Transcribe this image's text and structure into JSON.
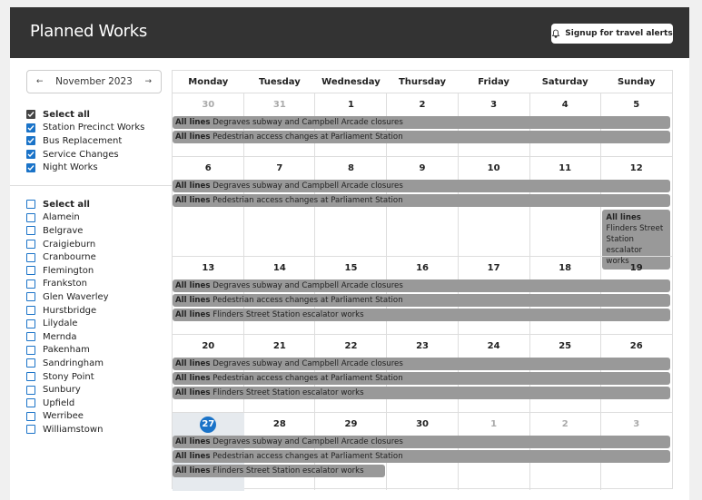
{
  "header": {
    "title": "Planned Works",
    "alert_button": "Signup for travel alerts"
  },
  "month_selector": {
    "label": "November 2023",
    "prev": "←",
    "next": "→"
  },
  "categories": {
    "select_all": "Select all",
    "items": [
      "Station Precinct Works",
      "Bus Replacement",
      "Service Changes",
      "Night Works"
    ]
  },
  "lines": {
    "select_all": "Select all",
    "items": [
      "Alamein",
      "Belgrave",
      "Craigieburn",
      "Cranbourne",
      "Flemington",
      "Frankston",
      "Glen Waverley",
      "Hurstbridge",
      "Lilydale",
      "Mernda",
      "Pakenham",
      "Sandringham",
      "Stony Point",
      "Sunbury",
      "Upfield",
      "Werribee",
      "Williamstown"
    ]
  },
  "weekdays": [
    "Monday",
    "Tuesday",
    "Wednesday",
    "Thursday",
    "Friday",
    "Saturday",
    "Sunday"
  ],
  "event_prefix": "All lines",
  "events": {
    "degraves": "Degraves subway and Campbell Arcade closures",
    "parliament": "Pedestrian access changes at Parliament Station",
    "flinders": "Flinders Street Station escalator works"
  },
  "weeks": [
    {
      "days": [
        "30",
        "31",
        "1",
        "2",
        "3",
        "4",
        "5"
      ]
    },
    {
      "days": [
        "6",
        "7",
        "8",
        "9",
        "10",
        "11",
        "12"
      ]
    },
    {
      "days": [
        "13",
        "14",
        "15",
        "16",
        "17",
        "18",
        "19"
      ]
    },
    {
      "days": [
        "20",
        "21",
        "22",
        "23",
        "24",
        "25",
        "26"
      ]
    },
    {
      "days": [
        "27",
        "28",
        "29",
        "30",
        "1",
        "2",
        "3"
      ]
    }
  ]
}
